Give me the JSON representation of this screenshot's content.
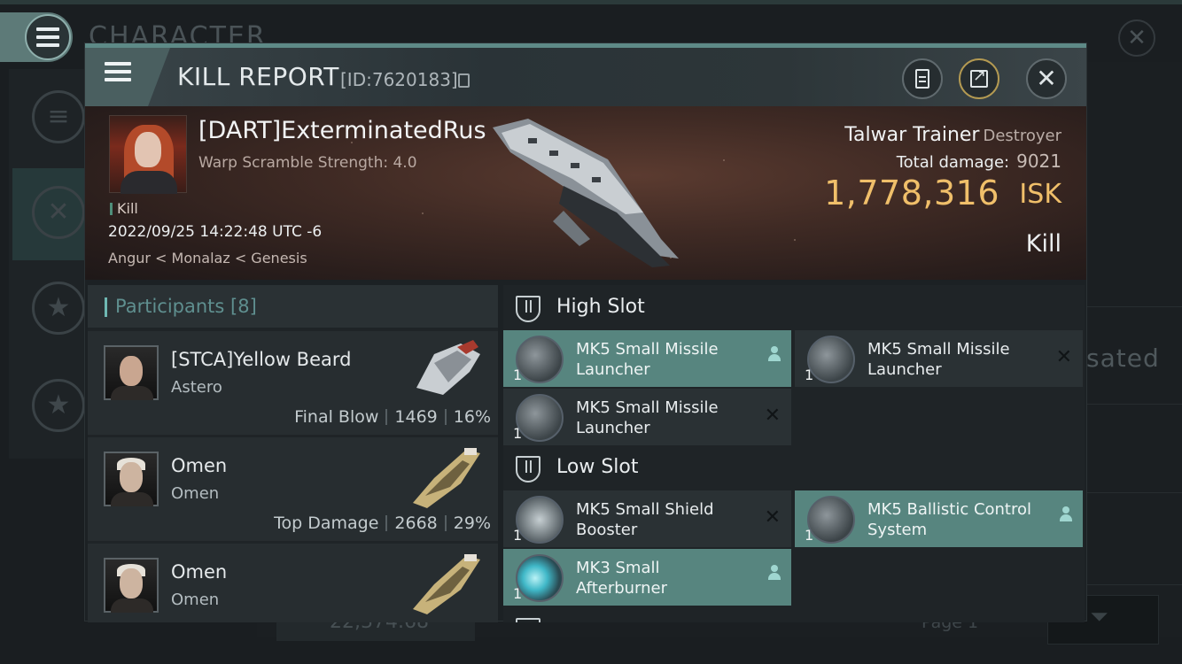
{
  "background": {
    "title": "CHARACTER",
    "side_word": "sated",
    "wallet": "22,374.68",
    "page": "Page 1"
  },
  "dialog": {
    "title": "KILL REPORT",
    "id": "[ID:7620183]"
  },
  "victim": {
    "name": "[DART]ExterminatedRus",
    "subtitle": "Warp Scramble Strength: 4.0",
    "tag": "Kill",
    "datetime": "2022/09/25 14:22:48 UTC -6",
    "location": "Angur < Monalaz < Genesis",
    "ship_name": "Talwar Trainer",
    "ship_class": "Destroyer",
    "total_damage_label": "Total damage:",
    "total_damage": "9021",
    "isk_value": "1,778,316",
    "isk_unit": "ISK",
    "result": "Kill"
  },
  "participants": {
    "title": "Participants",
    "count": "[8]",
    "rows": [
      {
        "name": "[STCA]Yellow Beard",
        "ship": "Astero",
        "tag": "Final Blow",
        "damage": "1469",
        "percent": "16%"
      },
      {
        "name": "Omen",
        "ship": "Omen",
        "tag": "Top Damage",
        "damage": "2668",
        "percent": "29%"
      },
      {
        "name": "Omen",
        "ship": "Omen",
        "tag": "",
        "damage": "",
        "percent": ""
      }
    ]
  },
  "slots": {
    "high": {
      "title": "High Slot",
      "items": [
        {
          "name": "MK5 Small Missile Launcher",
          "qty": "1",
          "state": "dropped"
        },
        {
          "name": "MK5 Small Missile Launcher",
          "qty": "1",
          "state": "destroyed"
        },
        {
          "name": "MK5 Small Missile Launcher",
          "qty": "1",
          "state": "destroyed"
        }
      ]
    },
    "low": {
      "title": "Low Slot",
      "items": [
        {
          "name": "MK5 Small Shield Booster",
          "qty": "1",
          "state": "destroyed"
        },
        {
          "name": "MK5 Ballistic Control System",
          "qty": "1",
          "state": "dropped"
        },
        {
          "name": "MK3 Small Afterburner",
          "qty": "1",
          "state": "dropped"
        }
      ]
    }
  },
  "colors": {
    "accent": "#57857f",
    "isk": "#f0bf6a",
    "header_line": "#5e8a87"
  }
}
